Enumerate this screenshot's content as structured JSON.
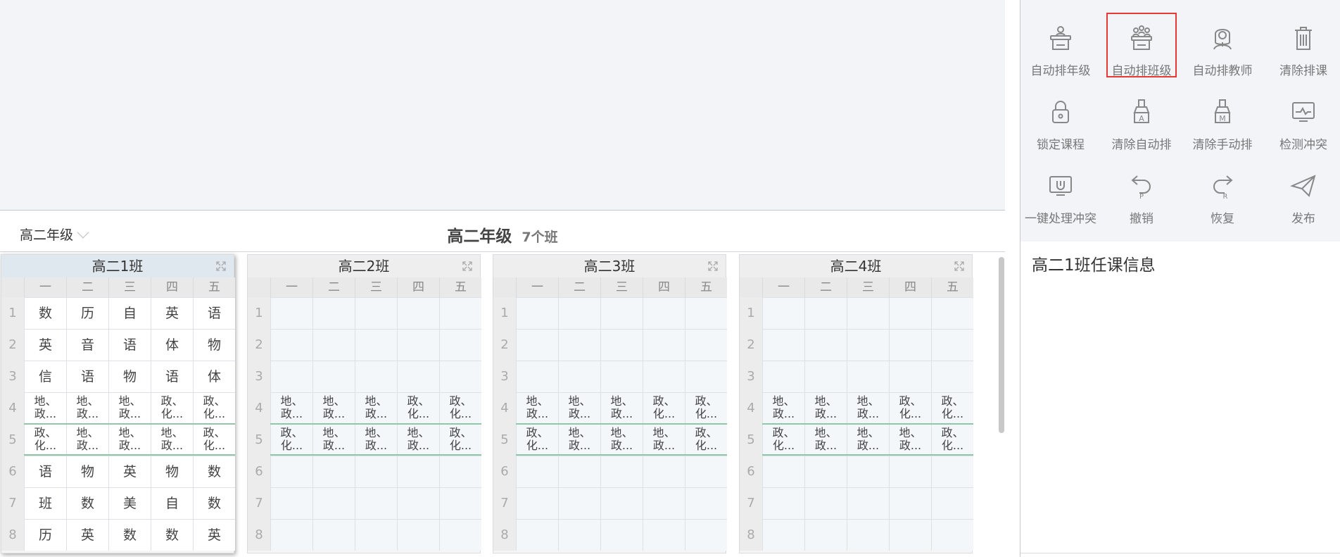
{
  "toolbar": {
    "items": [
      {
        "label": "自动排年级",
        "icon": "podium-person-icon"
      },
      {
        "label": "自动排班级",
        "icon": "podium-group-icon",
        "highlighted": true
      },
      {
        "label": "自动排教师",
        "icon": "teacher-icon"
      },
      {
        "label": "清除排课",
        "icon": "trash-icon"
      },
      {
        "label": "锁定课程",
        "icon": "lock-icon"
      },
      {
        "label": "清除自动排",
        "icon": "broom-a-icon"
      },
      {
        "label": "清除手动排",
        "icon": "broom-m-icon"
      },
      {
        "label": "检测冲突",
        "icon": "monitor-pulse-icon"
      },
      {
        "label": "一键处理冲突",
        "icon": "monitor-fix-icon"
      },
      {
        "label": "撤销",
        "icon": "undo-icon"
      },
      {
        "label": "恢复",
        "icon": "redo-icon"
      },
      {
        "label": "发布",
        "icon": "send-icon"
      }
    ]
  },
  "grade": {
    "select_value": "高二年级",
    "title": "高二年级",
    "class_count": "7个班"
  },
  "weekdays": [
    "一",
    "二",
    "三",
    "四",
    "五"
  ],
  "periods": [
    "1",
    "2",
    "3",
    "4",
    "5",
    "6",
    "7",
    "8"
  ],
  "classes": [
    {
      "name": "高二1班",
      "selected": true,
      "rows": [
        [
          "数",
          "历",
          "自",
          "英",
          "语"
        ],
        [
          "英",
          "音",
          "语",
          "体",
          "物"
        ],
        [
          "信",
          "语",
          "物",
          "语",
          "体"
        ],
        [
          "地、\n政...",
          "地、\n政...",
          "地、\n政...",
          "政、\n化...",
          "政、\n化..."
        ],
        [
          "政、\n化...",
          "地、\n政...",
          "地、\n政...",
          "地、\n政...",
          "政、\n化..."
        ],
        [
          "语",
          "物",
          "英",
          "物",
          "数"
        ],
        [
          "班",
          "数",
          "美",
          "自",
          "数"
        ],
        [
          "历",
          "英",
          "数",
          "数",
          "英"
        ]
      ]
    },
    {
      "name": "高二2班",
      "selected": false,
      "rows": [
        [
          "",
          "",
          "",
          "",
          ""
        ],
        [
          "",
          "",
          "",
          "",
          ""
        ],
        [
          "",
          "",
          "",
          "",
          ""
        ],
        [
          "地、\n政...",
          "地、\n政...",
          "地、\n政...",
          "政、\n化...",
          "政、\n化..."
        ],
        [
          "政、\n化...",
          "地、\n政...",
          "地、\n政...",
          "地、\n政...",
          "政、\n化..."
        ],
        [
          "",
          "",
          "",
          "",
          ""
        ],
        [
          "",
          "",
          "",
          "",
          ""
        ],
        [
          "",
          "",
          "",
          "",
          ""
        ]
      ]
    },
    {
      "name": "高二3班",
      "selected": false,
      "rows": [
        [
          "",
          "",
          "",
          "",
          ""
        ],
        [
          "",
          "",
          "",
          "",
          ""
        ],
        [
          "",
          "",
          "",
          "",
          ""
        ],
        [
          "地、\n政...",
          "地、\n政...",
          "地、\n政...",
          "政、\n化...",
          "政、\n化..."
        ],
        [
          "政、\n化...",
          "地、\n政...",
          "地、\n政...",
          "地、\n政...",
          "政、\n化..."
        ],
        [
          "",
          "",
          "",
          "",
          ""
        ],
        [
          "",
          "",
          "",
          "",
          ""
        ],
        [
          "",
          "",
          "",
          "",
          ""
        ]
      ]
    },
    {
      "name": "高二4班",
      "selected": false,
      "rows": [
        [
          "",
          "",
          "",
          "",
          ""
        ],
        [
          "",
          "",
          "",
          "",
          ""
        ],
        [
          "",
          "",
          "",
          "",
          ""
        ],
        [
          "地、\n政...",
          "地、\n政...",
          "地、\n政...",
          "政、\n化...",
          "政、\n化..."
        ],
        [
          "政、\n化...",
          "地、\n政...",
          "地、\n政...",
          "地、\n政...",
          "政、\n化..."
        ],
        [
          "",
          "",
          "",
          "",
          ""
        ],
        [
          "",
          "",
          "",
          "",
          ""
        ],
        [
          "",
          "",
          "",
          "",
          ""
        ]
      ]
    }
  ],
  "info": {
    "title": "高二1班任课信息"
  }
}
